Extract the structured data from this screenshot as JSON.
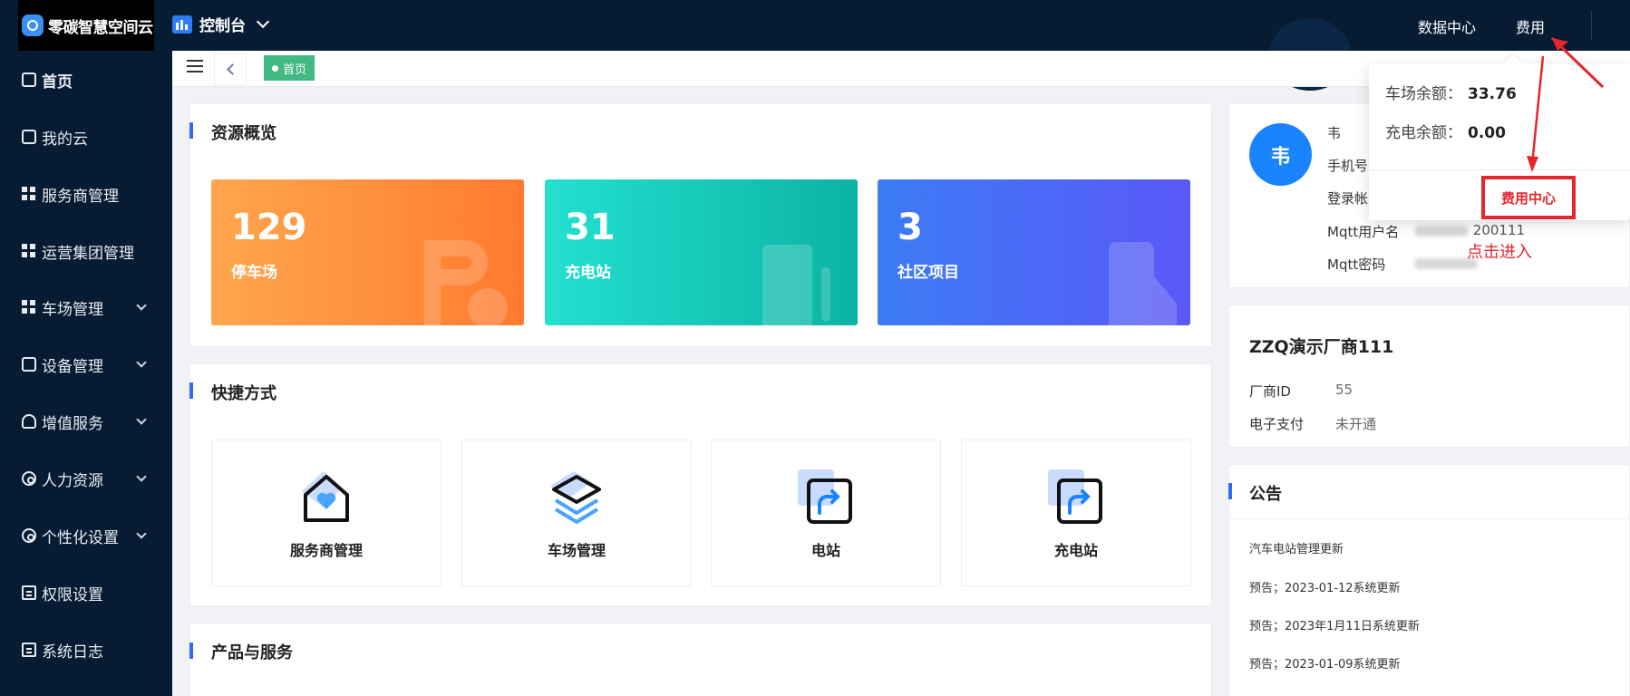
{
  "topbar": {
    "logo_text": "零碳智慧空间云",
    "console_label": "控制台",
    "nav": {
      "data_center": "数据中心",
      "fee": "费用"
    }
  },
  "sidebar": {
    "items": [
      {
        "label": "首页",
        "icon": "home-icon"
      },
      {
        "label": "我的云",
        "icon": "cloud-icon"
      },
      {
        "label": "服务商管理",
        "icon": "grid-icon"
      },
      {
        "label": "运营集团管理",
        "icon": "grid-icon"
      },
      {
        "label": "车场管理",
        "icon": "grid-icon"
      },
      {
        "label": "设备管理",
        "icon": "device-icon"
      },
      {
        "label": "增值服务",
        "icon": "star-icon"
      },
      {
        "label": "人力资源",
        "icon": "user-icon"
      },
      {
        "label": "个性化设置",
        "icon": "gear-icon"
      },
      {
        "label": "权限设置",
        "icon": "doc-icon"
      },
      {
        "label": "系统日志",
        "icon": "doc-icon"
      }
    ]
  },
  "tabs": {
    "home": "首页"
  },
  "overview": {
    "title": "资源概览",
    "stats": [
      {
        "value": "129",
        "label": "停车场",
        "icon": "parking-icon"
      },
      {
        "value": "31",
        "label": "充电站",
        "icon": "charger-icon"
      },
      {
        "value": "3",
        "label": "社区项目",
        "icon": "building-icon"
      }
    ]
  },
  "shortcuts": {
    "title": "快捷方式",
    "items": [
      {
        "label": "服务商管理",
        "icon": "home-heart-icon"
      },
      {
        "label": "车场管理",
        "icon": "layers-icon"
      },
      {
        "label": "电站",
        "icon": "share-icon"
      },
      {
        "label": "充电站",
        "icon": "share-icon"
      }
    ]
  },
  "products": {
    "title": "产品与服务"
  },
  "profile": {
    "avatar": "韦",
    "name": "韦",
    "rows": [
      {
        "label": "手机号"
      },
      {
        "label": "登录帐"
      },
      {
        "label": "Mqtt用户名",
        "value": "200111"
      },
      {
        "label": "Mqtt密码"
      }
    ]
  },
  "vendor": {
    "name": "ZZQ演示厂商111",
    "id_label": "厂商ID",
    "id_value": "55",
    "pay_label": "电子支付",
    "pay_value": "未开通"
  },
  "announcements": {
    "title": "公告",
    "items": [
      "汽车电站管理更新",
      "预告；2023-01-12系统更新",
      "预告；2023年1月11日系统更新",
      "预告；2023-01-09系统更新"
    ]
  },
  "fee_popup": {
    "parking_balance_label": "车场余额：",
    "parking_balance": "33.76",
    "charging_balance_label": "充电余额：",
    "charging_balance": "0.00",
    "fee_center": "费用中心",
    "click_tip": "点击进入"
  },
  "colors": {
    "sidebar_bg": "#071c33",
    "accent": "#2f6bf6",
    "tab_green": "#42b883",
    "annotation_red": "#e6262e"
  }
}
